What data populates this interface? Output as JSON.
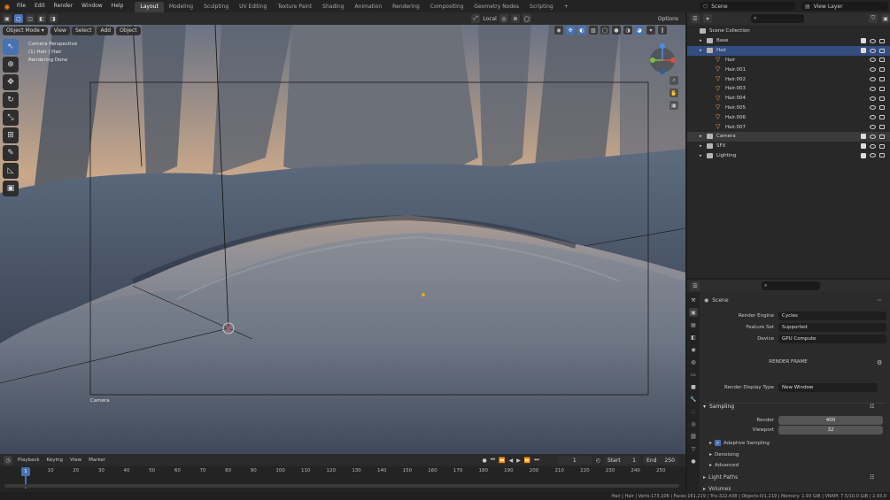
{
  "topbar": {
    "menus": [
      "File",
      "Edit",
      "Render",
      "Window",
      "Help"
    ],
    "tabs": [
      "Layout",
      "Modeling",
      "Sculpting",
      "UV Editing",
      "Texture Paint",
      "Shading",
      "Animation",
      "Rendering",
      "Compositing",
      "Geometry Nodes",
      "Scripting"
    ],
    "active_tab": "Layout",
    "add_tab": "+",
    "scene": "Scene",
    "view_layer": "View Layer"
  },
  "viewport_header": {
    "transform_orientation": "Local",
    "options_label": "Options"
  },
  "viewport": {
    "mode": "Object Mode",
    "menus": [
      "View",
      "Select",
      "Add",
      "Object"
    ],
    "overlay_lines": [
      "Camera Perspective",
      "(1) Hair | Hair",
      "Rendering Done"
    ],
    "camera_label": "Camera"
  },
  "timeline": {
    "menus": [
      "Playback",
      "Keying",
      "View",
      "Marker"
    ],
    "current_frame": "1",
    "start_label": "Start",
    "start_value": "1",
    "end_label": "End",
    "end_value": "250",
    "ruler": [
      "10",
      "20",
      "30",
      "40",
      "50",
      "60",
      "70",
      "80",
      "90",
      "100",
      "110",
      "120",
      "130",
      "140",
      "150",
      "160",
      "170",
      "180",
      "190",
      "200",
      "210",
      "220",
      "230",
      "240",
      "250"
    ],
    "playhead": "1"
  },
  "statusbar": {
    "text": "Hair | Hair | Verts:173,106 | Faces:161,219 | Tris:322,438 | Objects:0/1,219 | Memory: 1.93 GiB | VRAM: 7.5/10.0 GiB | 2.93.0"
  },
  "outliner": {
    "root": "Scene Collection",
    "rows": [
      {
        "label": "Base",
        "depth": 1,
        "type": "collection",
        "sel": ""
      },
      {
        "label": "Hair",
        "depth": 1,
        "type": "collection",
        "sel": "sel"
      },
      {
        "label": "Hair",
        "depth": 2,
        "type": "object",
        "sel": ""
      },
      {
        "label": "Hair.001",
        "depth": 2,
        "type": "object",
        "sel": ""
      },
      {
        "label": "Hair.002",
        "depth": 2,
        "type": "object",
        "sel": ""
      },
      {
        "label": "Hair.003",
        "depth": 2,
        "type": "object",
        "sel": ""
      },
      {
        "label": "Hair.004",
        "depth": 2,
        "type": "object",
        "sel": ""
      },
      {
        "label": "Hair.005",
        "depth": 2,
        "type": "object",
        "sel": ""
      },
      {
        "label": "Hair.006",
        "depth": 2,
        "type": "object",
        "sel": ""
      },
      {
        "label": "Hair.007",
        "depth": 2,
        "type": "object",
        "sel": ""
      },
      {
        "label": "Camera",
        "depth": 1,
        "type": "collection",
        "sel": "sel2"
      },
      {
        "label": "SFX",
        "depth": 1,
        "type": "collection",
        "sel": ""
      },
      {
        "label": "Lighting",
        "depth": 1,
        "type": "collection",
        "sel": ""
      }
    ]
  },
  "properties": {
    "breadcrumb": "Scene",
    "render_engine_label": "Render Engine",
    "render_engine": "Cycles",
    "feature_set_label": "Feature Set",
    "feature_set": "Supported",
    "device_label": "Device",
    "device": "GPU Compute",
    "render_frame": "RENDER FRAME",
    "display_type_label": "Render Display Type",
    "display_type": "New Window",
    "sampling": "Sampling",
    "render_label": "Render",
    "render_samples": "400",
    "viewport_label": "Viewport",
    "viewport_samples": "32",
    "adaptive": "Adaptive Sampling",
    "denoising": "Denoising",
    "advanced": "Advanced",
    "light_paths": "Light Paths",
    "volumes": "Volumes"
  }
}
